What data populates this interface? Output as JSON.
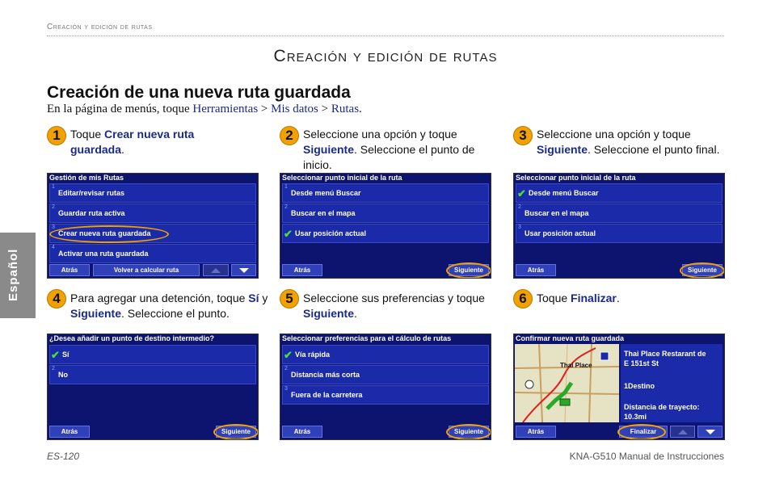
{
  "header": {
    "running_title": "Creación y edición de rutas",
    "chapter_title": "Creación y edición de rutas",
    "section_title": "Creación de una nueva ruta guardada"
  },
  "intro": {
    "prefix": "En la página de menús, toque ",
    "link1": "Herramientas",
    "sep1": " > ",
    "link2": "Mis datos",
    "sep2": " > ",
    "link3": "Rutas",
    "suffix": "."
  },
  "side_tab": "Español",
  "steps": [
    {
      "num": "1",
      "t1": "Toque ",
      "b1": "Crear nueva ruta guardada",
      "t2": "."
    },
    {
      "num": "2",
      "t1": "Seleccione una opción y toque ",
      "b1": "Siguiente",
      "t2": ". Seleccione el punto de inicio."
    },
    {
      "num": "3",
      "t1": "Seleccione una opción y toque ",
      "b1": "Siguiente",
      "t2": ". Seleccione el punto final."
    },
    {
      "num": "4",
      "t1": "Para agregar una detención, toque ",
      "b1": "Sí",
      "t2": " y ",
      "b2": "Siguiente",
      "t3": ". Seleccione el punto."
    },
    {
      "num": "5",
      "t1": "Seleccione sus preferencias y toque ",
      "b1": "Siguiente",
      "t2": "."
    },
    {
      "num": "6",
      "t1": "Toque ",
      "b1": "Finalizar",
      "t2": "."
    }
  ],
  "screens": {
    "s1": {
      "title": "Gestión de mis Rutas",
      "items": [
        "Editar/revisar rutas",
        "Guardar ruta activa",
        "Crear nueva ruta guardada",
        "Activar una ruta guardada"
      ],
      "indices": [
        "1",
        "2",
        "3",
        "4"
      ],
      "back": "Atrás",
      "recalc": "Volver a calcular ruta"
    },
    "s2": {
      "title": "Seleccionar punto inicial de la ruta",
      "items": [
        "Desde menú Buscar",
        "Buscar en el mapa",
        "Usar posición actual"
      ],
      "indices": [
        "1",
        "2",
        "3"
      ],
      "back": "Atrás",
      "next": "Siguiente"
    },
    "s3": {
      "title": "Seleccionar punto inicial de la ruta",
      "items": [
        "Desde menú Buscar",
        "Buscar en el mapa",
        "Usar posición actual"
      ],
      "indices": [
        "1",
        "2",
        "3"
      ],
      "back": "Atrás",
      "next": "Siguiente"
    },
    "s4": {
      "title": "¿Desea añadir un punto de destino intermedio?",
      "items": [
        "Sí",
        "No"
      ],
      "indices": [
        "1",
        "2"
      ],
      "back": "Atrás",
      "next": "Siguiente"
    },
    "s5": {
      "title": "Seleccionar preferencias para el cálculo de rutas",
      "items": [
        "Vía rápida",
        "Distancia más corta",
        "Fuera de la carretera"
      ],
      "indices": [
        "1",
        "2",
        "3"
      ],
      "back": "Atrás",
      "next": "Siguiente"
    },
    "s6": {
      "title": "Confirmar nueva ruta guardada",
      "dest_line1": "Thai Place Restarant de",
      "dest_line2": "E 151st St",
      "stops": "1Destino",
      "dist_label": "Distancia de trayecto:",
      "dist_value": "10.3mi",
      "map_label": "Thai Place",
      "back": "Atrás",
      "finish": "Finalizar"
    }
  },
  "footer": {
    "page": "ES-120",
    "manual": "KNA-G510 Manual de Instrucciones"
  },
  "colors": {
    "accent": "#f2a200",
    "link": "#1a2a8a",
    "screen_bg": "#0c1470",
    "check": "#4ddb3a"
  }
}
